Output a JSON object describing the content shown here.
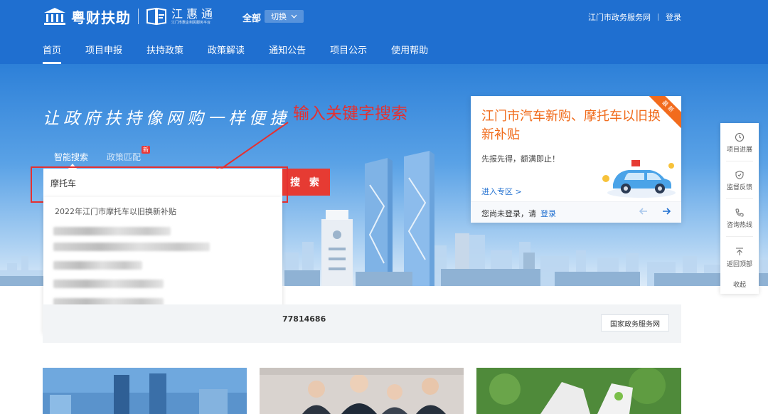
{
  "header": {
    "brand": "粤财扶助",
    "brand2": "江惠通",
    "brand2_sub": "江门市惠企利民服务平台",
    "region": "全部",
    "switch_label": "切换",
    "gov_site": "江门市政务服务网",
    "login": "登录"
  },
  "nav": {
    "items": [
      {
        "label": "首页",
        "active": true
      },
      {
        "label": "项目申报"
      },
      {
        "label": "扶持政策"
      },
      {
        "label": "政策解读"
      },
      {
        "label": "通知公告"
      },
      {
        "label": "项目公示"
      },
      {
        "label": "使用帮助"
      }
    ]
  },
  "hero": {
    "slogan": "让政府扶持像网购一样便捷",
    "annotation": "输入关键字搜索"
  },
  "search": {
    "tab_smart": "智能搜索",
    "tab_policy": "政策匹配",
    "new_badge": "新",
    "value": "摩托车",
    "button": "搜 索",
    "suggestion_first": "2022年江门市摩托车以旧换新补贴"
  },
  "promo": {
    "ribbon": "最新",
    "title": "江门市汽车新购、摩托车以旧换新补贴",
    "subtitle": "先报先得，额满即止！",
    "link": "进入专区 >",
    "login_prompt": "您尚未登录，请",
    "login_link": "登录"
  },
  "side_tools": {
    "items": [
      {
        "label": "项目进展",
        "icon": "clock-icon"
      },
      {
        "label": "监督反馈",
        "icon": "shield-icon"
      },
      {
        "label": "咨询热线",
        "icon": "phone-icon"
      },
      {
        "label": "返回顶部",
        "icon": "arrow-up-icon"
      }
    ],
    "collapse": "收起"
  },
  "info": {
    "phone_partial": "77814686",
    "gov_button": "国家政务服务网"
  },
  "colors": {
    "brand_blue": "#1f6fd0",
    "search_red": "#e63b33",
    "promo_orange": "#f06a1a",
    "annotation_red": "#e53030"
  }
}
